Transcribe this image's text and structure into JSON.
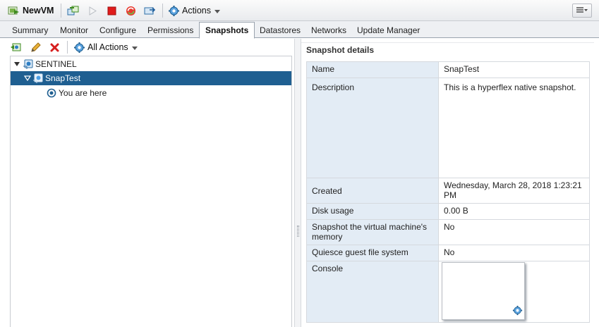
{
  "toolbar": {
    "vm_name": "NewVM",
    "actions_label": "Actions"
  },
  "tabs": [
    {
      "label": "Summary",
      "active": false
    },
    {
      "label": "Monitor",
      "active": false
    },
    {
      "label": "Configure",
      "active": false
    },
    {
      "label": "Permissions",
      "active": false
    },
    {
      "label": "Snapshots",
      "active": true
    },
    {
      "label": "Datastores",
      "active": false
    },
    {
      "label": "Networks",
      "active": false
    },
    {
      "label": "Update Manager",
      "active": false
    }
  ],
  "snapshot_toolbar": {
    "all_actions_label": "All Actions"
  },
  "tree": {
    "root": "SENTINEL",
    "child": "SnapTest",
    "current": "You are here"
  },
  "details": {
    "title": "Snapshot details",
    "rows": {
      "name": {
        "label": "Name",
        "value": "SnapTest"
      },
      "description": {
        "label": "Description",
        "value": "This is a hyperflex native snapshot."
      },
      "created": {
        "label": "Created",
        "value": "Wednesday, March 28, 2018 1:23:21 PM"
      },
      "disk_usage": {
        "label": "Disk usage",
        "value": "0.00 B"
      },
      "memory": {
        "label": "Snapshot the virtual machine's memory",
        "value": "No"
      },
      "quiesce": {
        "label": "Quiesce guest file system",
        "value": "No"
      },
      "console": {
        "label": "Console"
      }
    }
  },
  "colors": {
    "selection": "#1f5f91",
    "label_cell": "#e3ecf5",
    "accent_blue": "#2d7ec4"
  }
}
